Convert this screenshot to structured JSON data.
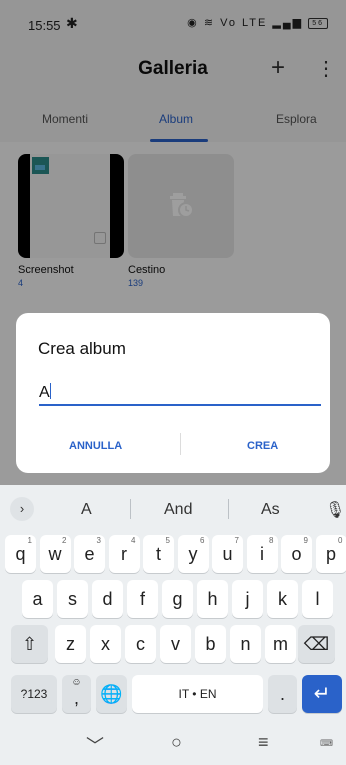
{
  "status_bar": {
    "time": "15:55",
    "settings_icon": "gear-icon",
    "indicators": "Vo LTE",
    "battery": "56"
  },
  "app_bar": {
    "title": "Galleria",
    "add_icon": "plus-icon",
    "more_icon": "more-vert-icon"
  },
  "tabs": [
    {
      "label": "Momenti"
    },
    {
      "label": "Album",
      "active": true
    },
    {
      "label": "Esplora"
    }
  ],
  "albums": [
    {
      "name": "Screenshot",
      "count": "4"
    },
    {
      "name": "Cestino",
      "count": "139"
    }
  ],
  "dialog": {
    "title": "Crea album",
    "input_value": "A",
    "cancel_label": "ANNULLA",
    "confirm_label": "CREA"
  },
  "keyboard": {
    "suggestions": [
      "A",
      "And",
      "As"
    ],
    "row1": [
      {
        "k": "q",
        "n": "1"
      },
      {
        "k": "w",
        "n": "2"
      },
      {
        "k": "e",
        "n": "3"
      },
      {
        "k": "r",
        "n": "4"
      },
      {
        "k": "t",
        "n": "5"
      },
      {
        "k": "y",
        "n": "6"
      },
      {
        "k": "u",
        "n": "7"
      },
      {
        "k": "i",
        "n": "8"
      },
      {
        "k": "o",
        "n": "9"
      },
      {
        "k": "p",
        "n": "0"
      }
    ],
    "row2": [
      "a",
      "s",
      "d",
      "f",
      "g",
      "h",
      "j",
      "k",
      "l"
    ],
    "row3": [
      "z",
      "x",
      "c",
      "v",
      "b",
      "n",
      "m"
    ],
    "sym_label": "?123",
    "comma_label": ",",
    "space_label": "IT • EN",
    "period_label": ".",
    "accent_color": "#2a62c9"
  },
  "navbar": {
    "back_icon": "chevron-down-icon",
    "home_icon": "home-circle-icon",
    "recents_icon": "menu-lines-icon",
    "keyboard_icon": "keyboard-icon"
  }
}
